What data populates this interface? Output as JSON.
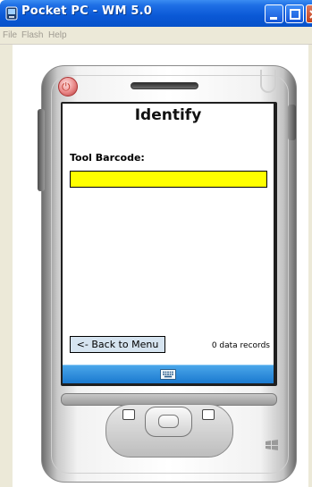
{
  "window": {
    "title": "Pocket PC - WM 5.0"
  },
  "menu": {
    "items": [
      "File",
      "Flash",
      "Help"
    ]
  },
  "screen": {
    "title": "Identify",
    "barcode_label": "Tool Barcode:",
    "barcode_value": "",
    "back_button_label": "<- Back to Menu",
    "record_count": "0 data records"
  },
  "icons": {
    "app": "pocket-pc-icon",
    "minimize": "minimize-icon",
    "maximize": "maximize-icon",
    "close": "close-icon",
    "keyboard": "keyboard-icon",
    "power": "power-icon",
    "windows": "windows-logo-icon"
  },
  "colors": {
    "titlebar": "#0a58d6",
    "input_background": "#ffff00",
    "taskbar": "#1a79cf",
    "back_button": "#d6e4f0"
  }
}
